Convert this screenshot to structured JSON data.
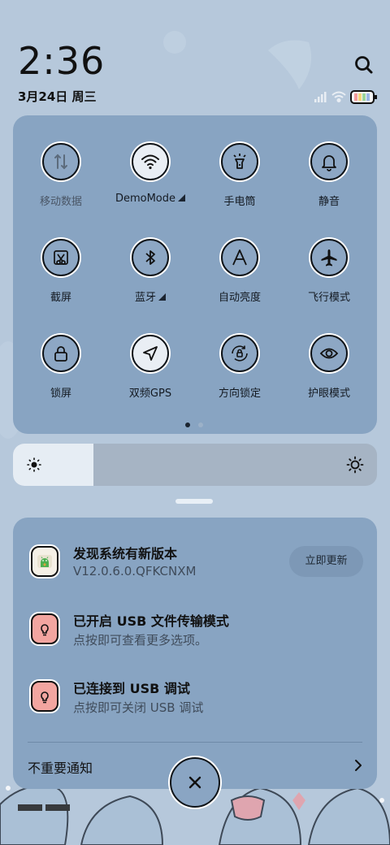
{
  "status": {
    "time": "2:36",
    "date": "3月24日 周三"
  },
  "quick_settings": {
    "tiles": [
      {
        "label": "移动数据",
        "icon": "mobile-data-icon",
        "enabled": false
      },
      {
        "label": "DemoMode",
        "icon": "wifi-icon",
        "enabled": true,
        "expandable": true
      },
      {
        "label": "手电筒",
        "icon": "flashlight-icon",
        "enabled": true
      },
      {
        "label": "静音",
        "icon": "bell-icon",
        "enabled": true
      },
      {
        "label": "截屏",
        "icon": "screenshot-icon",
        "enabled": true
      },
      {
        "label": "蓝牙",
        "icon": "bluetooth-icon",
        "enabled": true,
        "expandable": true
      },
      {
        "label": "自动亮度",
        "icon": "auto-brightness-icon",
        "enabled": true
      },
      {
        "label": "飞行模式",
        "icon": "airplane-icon",
        "enabled": true
      },
      {
        "label": "锁屏",
        "icon": "lock-icon",
        "enabled": true
      },
      {
        "label": "双频GPS",
        "icon": "location-arrow-icon",
        "enabled": true
      },
      {
        "label": "方向锁定",
        "icon": "rotation-lock-icon",
        "enabled": true
      },
      {
        "label": "护眼模式",
        "icon": "eye-icon",
        "enabled": true
      }
    ],
    "page_count": 2,
    "current_page": 1
  },
  "brightness": {
    "level": 0.22
  },
  "notifications": {
    "items": [
      {
        "title": "发现系统有新版本",
        "subtitle": "V12.0.6.0.QFKCNXM",
        "action": "立即更新",
        "icon": "android-update-icon"
      },
      {
        "title": "已开启 USB 文件传输模式",
        "subtitle": "点按即可查看更多选项。",
        "icon": "usb-bulb-icon"
      },
      {
        "title": "已连接到 USB 调试",
        "subtitle": "点按即可关闭 USB 调试",
        "icon": "usb-bulb-icon"
      }
    ],
    "unimportant_label": "不重要通知"
  },
  "colors": {
    "panel": "#88a4c2",
    "wallpaper": "#b6c8db",
    "tile_outline": "#0f1419",
    "usb_icon_bg": "#f2a5a0",
    "update_icon_bg": "#f5f0e6"
  }
}
